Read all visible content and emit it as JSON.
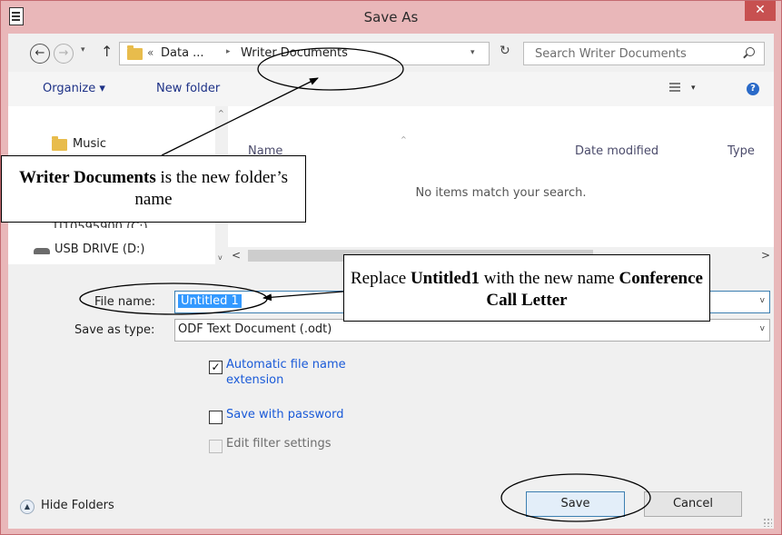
{
  "window": {
    "title": "Save As",
    "close_label": "✕"
  },
  "address": {
    "back_glyph": "←",
    "forward_glyph": "→",
    "up_glyph": "↑",
    "dropdown_glyph": "▾",
    "path_overflow": "«",
    "path_parent": "Data ...",
    "path_separator": "▸",
    "path_current": "Writer Documents",
    "refresh_glyph": "↻"
  },
  "search": {
    "placeholder": "Search Writer Documents"
  },
  "toolbar": {
    "organize_label": "Organize ▾",
    "new_folder_label": "New folder",
    "view_dropdown": "▾",
    "help_glyph": "?"
  },
  "nav": {
    "items": [
      {
        "label": "Music",
        "icon": "music-folder-icon"
      },
      {
        "label": "TI10595900 (C:)",
        "icon": "drive-icon"
      },
      {
        "label": "USB DRIVE (D:)",
        "icon": "usb-drive-icon"
      }
    ],
    "scroll_up": "^",
    "scroll_down": "v"
  },
  "files": {
    "columns": [
      "Name",
      "Date modified",
      "Type"
    ],
    "sort_indicator": "^",
    "empty_message": "No items match your search.",
    "hscroll_left": "<",
    "hscroll_right": ">"
  },
  "form": {
    "filename_label": "File name:",
    "filename_value": "Untitled 1",
    "type_label": "Save as type:",
    "type_value": "ODF Text Document (.odt)",
    "dropdown_glyph": "v",
    "auto_ext_label": "Automatic file name extension",
    "auto_ext_checked": true,
    "password_label": "Save with password",
    "password_checked": false,
    "filter_label": "Edit filter settings",
    "filter_enabled": false,
    "check_glyph": "✓"
  },
  "footer": {
    "hide_folders_label": "Hide Folders",
    "hide_icon_glyph": "▲",
    "save_label": "Save",
    "cancel_label": "Cancel"
  },
  "annotations": {
    "callout1_bold": "Writer Documents",
    "callout1_rest": " is the new folder’s name",
    "callout2_pre": "Replace ",
    "callout2_bold1": "Untitled1",
    "callout2_mid": " with the new name ",
    "callout2_bold2": "Conference Call Letter"
  },
  "colors": {
    "titlebar": "#e9b7b9",
    "close": "#c75050",
    "link": "#1a5ad8",
    "selection": "#3399ff"
  }
}
